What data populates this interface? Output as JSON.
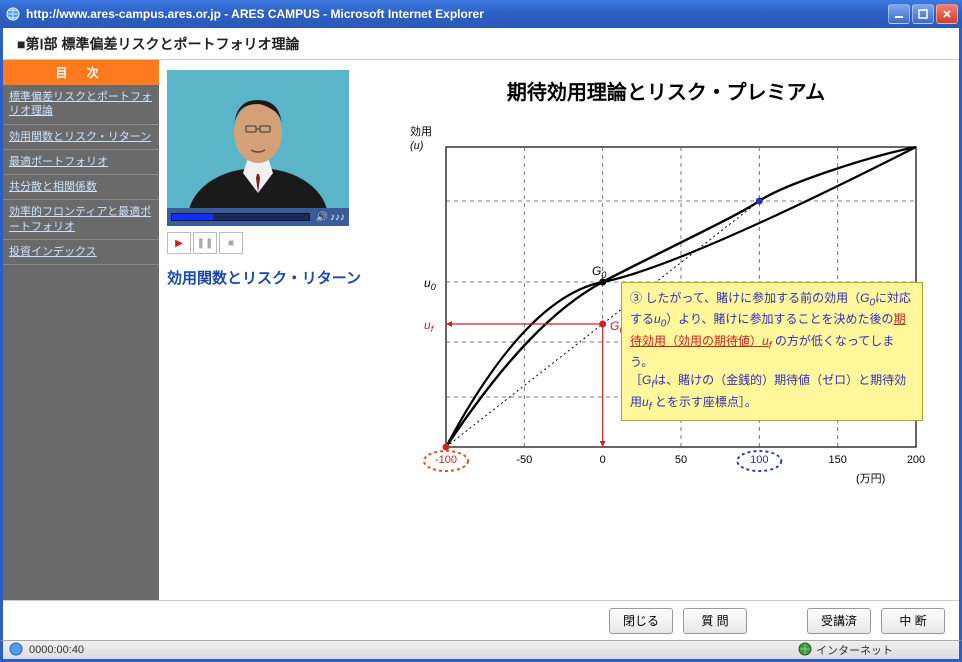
{
  "window": {
    "title": "http://www.ares-campus.ares.or.jp - ARES CAMPUS - Microsoft Internet Explorer"
  },
  "course": {
    "part_label": "■第Ⅰ部 標準偏差リスクとポートフォリオ理論"
  },
  "sidebar": {
    "heading": "目 次",
    "items": [
      {
        "label": "標準偏差リスクとポートフォリオ理論"
      },
      {
        "label": "効用関数とリスク・リターン"
      },
      {
        "label": "最適ポートフォリオ"
      },
      {
        "label": "共分散と相関係数"
      },
      {
        "label": "効率的フロンティアと最適ポートフォリオ"
      },
      {
        "label": "投資インデックス"
      }
    ]
  },
  "video": {
    "slide_title": "効用関数とリスク・リターン",
    "volume_label": "♪♪♪"
  },
  "chart_data": {
    "type": "line",
    "title": "期待効用理論とリスク・プレミアム",
    "xlabel": "(万円)",
    "ylabel": "効用",
    "ylabel_sub": "(u)",
    "x_ticks": [
      -100,
      -50,
      0,
      50,
      100,
      150,
      200
    ],
    "y_refs": [
      "u0",
      "uf"
    ],
    "series": [
      {
        "name": "utility_curve",
        "desc": "concave utility curve from (-100, bottom) to (200, top)",
        "x": [
          -100,
          -50,
          0,
          50,
          100,
          150,
          200
        ],
        "y_rel": [
          0.0,
          0.35,
          0.55,
          0.7,
          0.82,
          0.92,
          1.0
        ]
      },
      {
        "name": "chord",
        "desc": "straight chord between endpoints (-100) and (100) representing expected utility of gamble",
        "x": [
          -100,
          100
        ],
        "y_rel": [
          0.0,
          0.82
        ]
      }
    ],
    "markers": [
      {
        "name": "G0",
        "x": 0,
        "on": "utility_curve",
        "label": "G0"
      },
      {
        "name": "Gf",
        "x": 0,
        "on": "chord",
        "label": "Gf"
      },
      {
        "name": "right_marker",
        "x": 100,
        "on": "utility_curve"
      },
      {
        "name": "left_marker_ellipse",
        "x": -100,
        "highlight_color": "#e05020"
      },
      {
        "name": "right_marker_ellipse",
        "x": 100,
        "highlight_color": "#3040c0"
      }
    ],
    "annotation": {
      "lines": [
        "③ したがって、賭けに参加する前の効用（G0に対応する u0）より、賭けに参加することを決めた後の期待効用（効用の期待値）uf の方が低くなってしまう。",
        "［Gf は、賭けの（金銭的）期待値（ゼロ）と期待効用 uf とを示す座標点］。"
      ]
    }
  },
  "footer": {
    "close": "閉じる",
    "question": "質 問",
    "done": "受講済",
    "interrupt": "中 断"
  },
  "status": {
    "time": "0000:00:40",
    "zone": "インターネット"
  }
}
